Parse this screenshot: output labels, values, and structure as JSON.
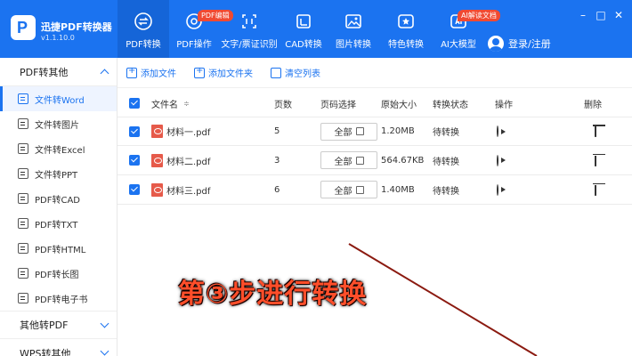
{
  "app": {
    "name": "迅捷PDF转换器",
    "version": "v1.1.10.0"
  },
  "window_controls": {
    "minimize": "–",
    "maximize": "□",
    "close": "✕"
  },
  "nav": [
    {
      "label": "PDF转换",
      "icon": "convert-icon",
      "active": true
    },
    {
      "label": "PDF操作",
      "icon": "pdf-operate-icon",
      "badge": "PDF编辑"
    },
    {
      "label": "文字/票证识别",
      "icon": "ocr-icon"
    },
    {
      "label": "CAD转换",
      "icon": "cad-icon"
    },
    {
      "label": "图片转换",
      "icon": "image-icon"
    },
    {
      "label": "特色转换",
      "icon": "special-icon"
    },
    {
      "label": "AI大模型",
      "icon": "ai-icon",
      "badge": "AI解读文档"
    }
  ],
  "login": {
    "label": "登录/注册"
  },
  "sidebar": {
    "group1": "PDF转其他",
    "items": [
      {
        "label": "文件转Word",
        "active": true
      },
      {
        "label": "文件转图片"
      },
      {
        "label": "文件转Excel"
      },
      {
        "label": "文件转PPT"
      },
      {
        "label": "PDF转CAD"
      },
      {
        "label": "PDF转TXT"
      },
      {
        "label": "PDF转HTML"
      },
      {
        "label": "PDF转长图"
      },
      {
        "label": "PDF转电子书"
      }
    ],
    "group2": "其他转PDF",
    "group3": "WPS转其他"
  },
  "toolbar": {
    "add_file": "添加文件",
    "add_folder": "添加文件夹",
    "clear_list": "清空列表"
  },
  "table": {
    "headers": {
      "name": "文件名",
      "sort": "≑",
      "pages": "页数",
      "range": "页码选择",
      "size": "原始大小",
      "status": "转换状态",
      "op": "操作",
      "del": "删除"
    },
    "rows": [
      {
        "name": "材料一.pdf",
        "pages": "5",
        "range": "全部",
        "size": "1.20MB",
        "status": "待转换"
      },
      {
        "name": "材料二.pdf",
        "pages": "3",
        "range": "全部",
        "size": "564.67KB",
        "status": "待转换"
      },
      {
        "name": "材料三.pdf",
        "pages": "6",
        "range": "全部",
        "size": "1.40MB",
        "status": "待转换"
      }
    ]
  },
  "overlay": {
    "step_text": "第③步进行转换"
  },
  "colors": {
    "brand": "#1b73f0",
    "badge": "#f04a32",
    "overlay_text": "#ff4e2a"
  }
}
